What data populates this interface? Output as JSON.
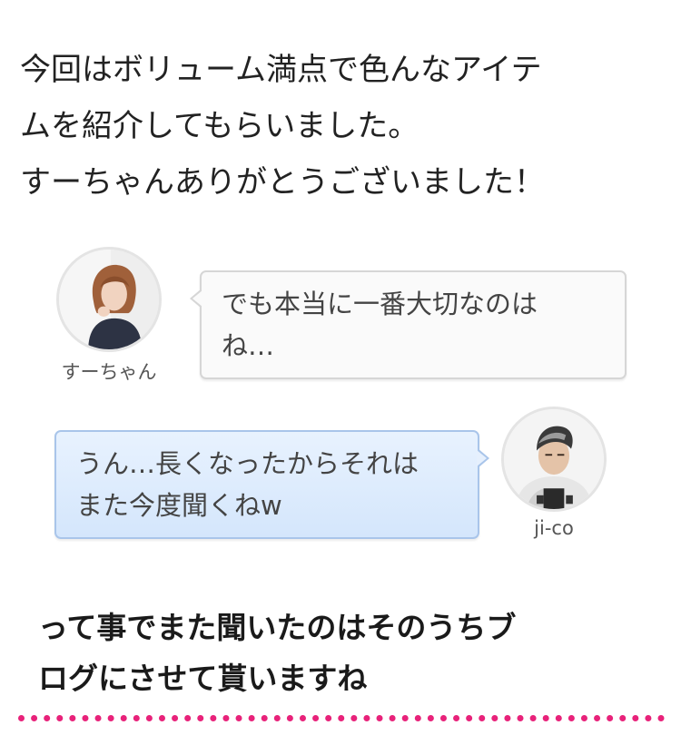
{
  "intro": {
    "lines": [
      "今回はボリューム満点で色んなアイテ",
      "ムを紹介してもらいました。",
      "すーちゃんありがとうございました！"
    ]
  },
  "conversation": [
    {
      "speaker": "すーちゃん",
      "side": "left",
      "avatar_icon": "woman-avatar-icon",
      "lines": [
        "でも本当に一番大切なのは",
        "ね…"
      ]
    },
    {
      "speaker": "ji-co",
      "side": "right",
      "avatar_icon": "man-avatar-icon",
      "lines": [
        "うん…長くなったからそれは",
        "また今度聞くねw"
      ]
    }
  ],
  "closing": {
    "lines": [
      "って事でまた聞いたのはそのうちブ",
      "ログにさせて貰いますね"
    ]
  },
  "colors": {
    "divider": "#e8227a",
    "bubble_right_bg": "#dbeafd",
    "bubble_right_border": "#a9c5ea",
    "bubble_left_bg": "#fafafa",
    "bubble_left_border": "#d6d6d6"
  }
}
